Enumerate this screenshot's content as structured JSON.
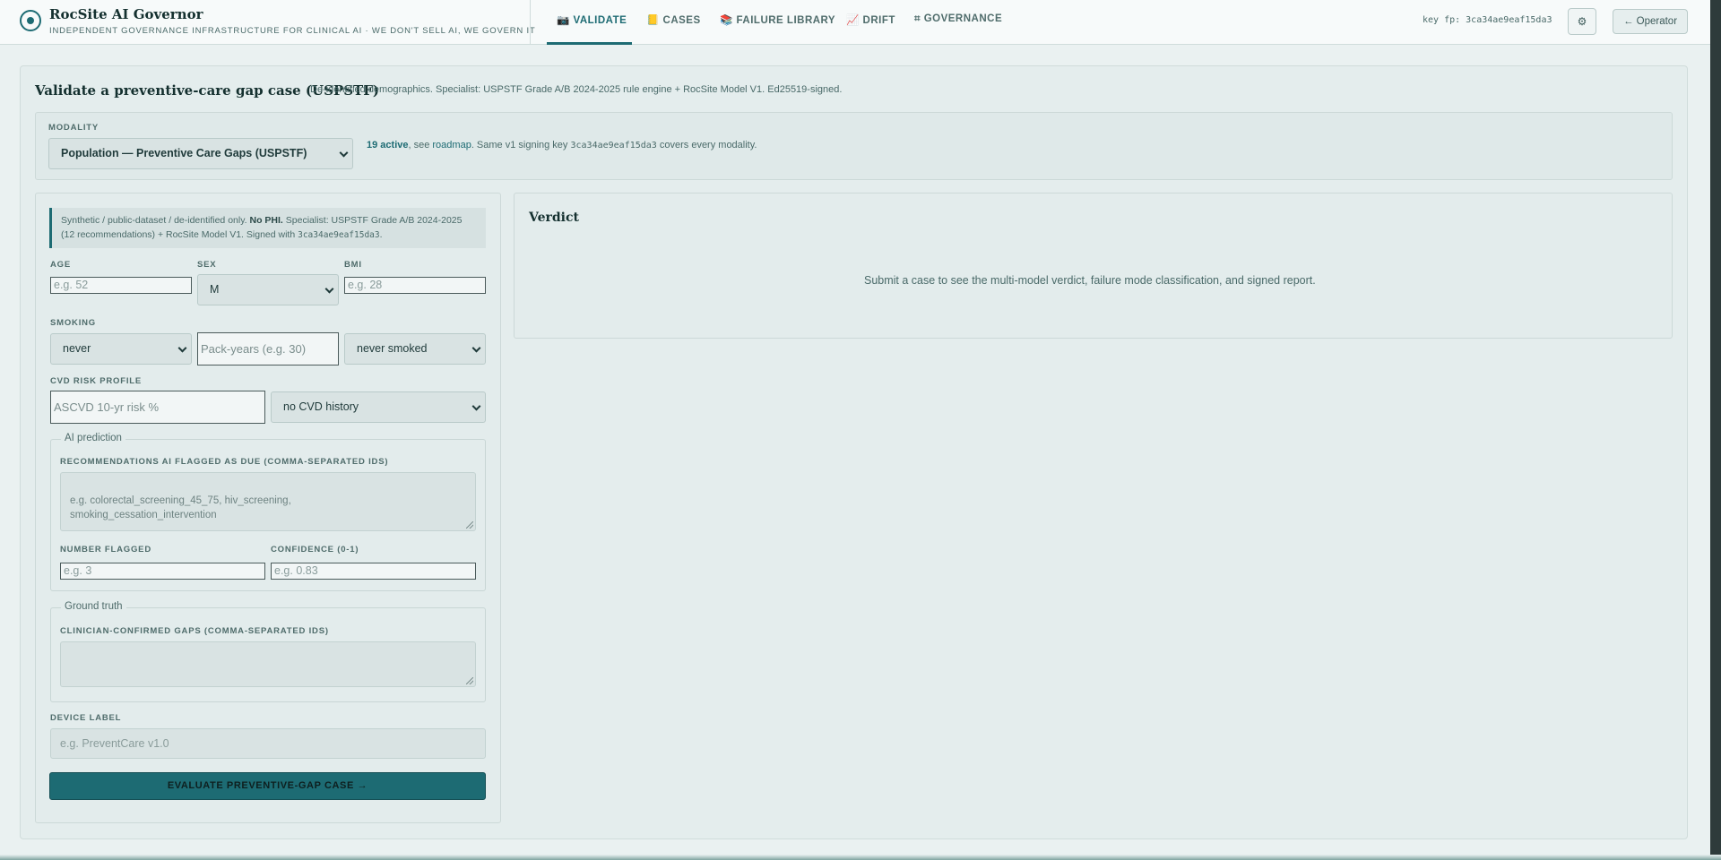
{
  "header": {
    "title": "RocSite AI Governor",
    "subtitle": "Independent governance infrastructure for clinical AI · we don't sell AI, we govern it",
    "tabs": [
      {
        "icon": "camera-icon",
        "glyph": "📷",
        "label": "Validate",
        "active": true
      },
      {
        "icon": "ledger-icon",
        "glyph": "📒",
        "label": "Cases",
        "active": false
      },
      {
        "icon": "books-icon",
        "glyph": "📚",
        "label": "Failure Library",
        "active": false
      },
      {
        "icon": "chart-icon",
        "glyph": "📈",
        "label": "Drift",
        "active": false
      },
      {
        "icon": "hash-icon",
        "glyph": "⌗",
        "label": "Governance",
        "active": false
      }
    ],
    "key_fp": "key fp: 3ca34ae9eaf15da3",
    "settings_icon": "gear-icon",
    "settings_glyph": "⚙",
    "operator_label": "← Operator"
  },
  "page": {
    "title": "Validate a preventive-care gap case (USPSTF)",
    "description": "De-identified demographics. Specialist: USPSTF Grade A/B 2024-2025 rule engine + RocSite Model V1. Ed25519-signed."
  },
  "modality": {
    "label": "Modality",
    "selected": "Population — Preventive Care Gaps (USPSTF)",
    "note_active": "19 active",
    "note_see": ", see ",
    "note_link": "roadmap",
    "note_mid": ". Same v1 signing key ",
    "note_key": "3ca34ae9eaf15da3",
    "note_end": " covers every modality."
  },
  "form": {
    "notice_1": "Synthetic / public-dataset / de-identified only. ",
    "notice_bold": "No PHI.",
    "notice_2": " Specialist: USPSTF Grade A/B 2024-2025 (12 recommendations) + RocSite Model V1. Signed with ",
    "notice_key": "3ca34ae9eaf15da3",
    "notice_end": ".",
    "age_label": "Age",
    "age_placeholder": "e.g. 52",
    "sex_label": "Sex",
    "sex_value": "M",
    "bmi_label": "BMI",
    "bmi_placeholder": "e.g. 28",
    "smoking_label": "Smoking",
    "smoking_value": "never",
    "pack_years_placeholder": "Pack-years (e.g. 30)",
    "smoking_status_value": "never smoked",
    "cvd_label": "CVD risk profile",
    "ascvd_placeholder": "ASCVD 10-yr risk %",
    "cvd_history_value": "no CVD history",
    "ai_prediction": {
      "legend": "AI prediction",
      "recs_label": "Recommendations AI flagged as due (comma-separated IDs)",
      "recs_placeholder": "e.g. colorectal_screening_45_75, hiv_screening,\nsmoking_cessation_intervention",
      "number_label": "Number flagged",
      "number_placeholder": "e.g. 3",
      "confidence_label": "Confidence (0-1)",
      "confidence_placeholder": "e.g. 0.83"
    },
    "ground_truth": {
      "legend": "Ground truth",
      "gaps_label": "Clinician-confirmed gaps (comma-separated IDs)",
      "gaps_placeholder": ""
    },
    "device_label": "Device label",
    "device_placeholder": "e.g. PreventCare v1.0",
    "submit_label": "Evaluate preventive-gap case →"
  },
  "verdict": {
    "title": "Verdict",
    "empty_text": "Submit a case to see the multi-model verdict, failure mode classification, and signed report."
  },
  "colors": {
    "accent": "#1d6b73",
    "background": "#eaf1f1",
    "text": "#1f3a3a"
  }
}
